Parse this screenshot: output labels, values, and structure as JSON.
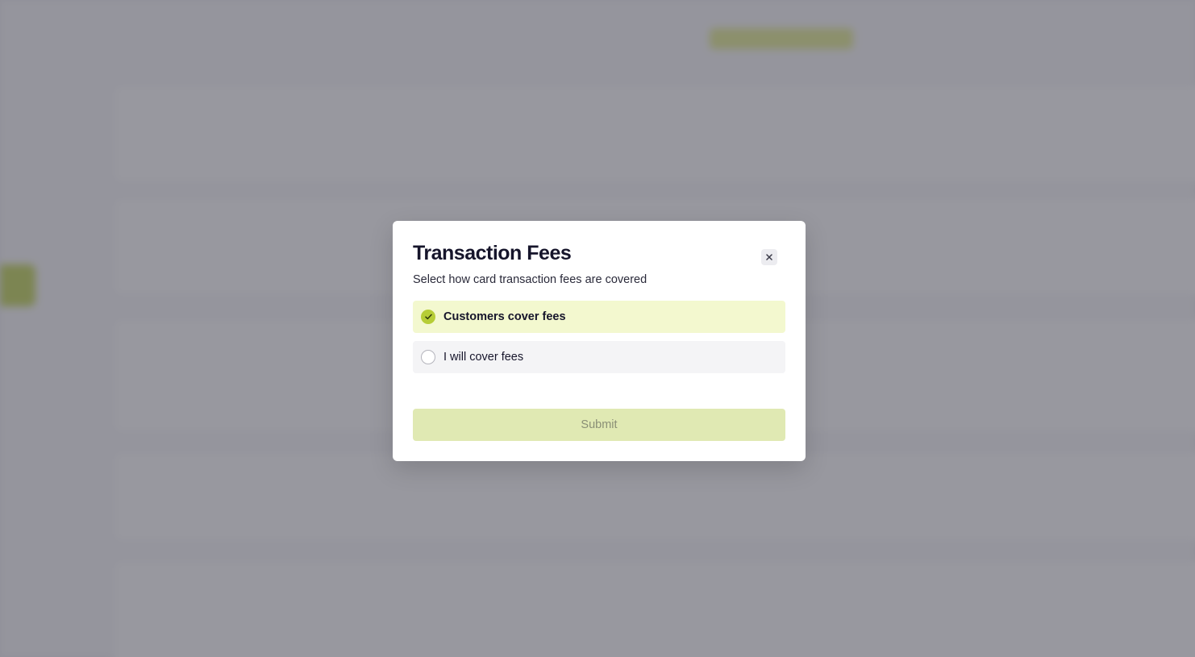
{
  "modal": {
    "title": "Transaction Fees",
    "subtitle": "Select how card transaction fees are covered",
    "options": [
      {
        "label": "Customers cover fees",
        "selected": true
      },
      {
        "label": "I will cover fees",
        "selected": false
      }
    ],
    "submit_label": "Submit"
  },
  "colors": {
    "accent": "#b6cd36",
    "selected_bg": "#f3f8cf",
    "submit_disabled_bg": "#e0e9b3",
    "title_text": "#16152b"
  },
  "icons": {
    "close": "close-icon",
    "check": "check-icon"
  }
}
